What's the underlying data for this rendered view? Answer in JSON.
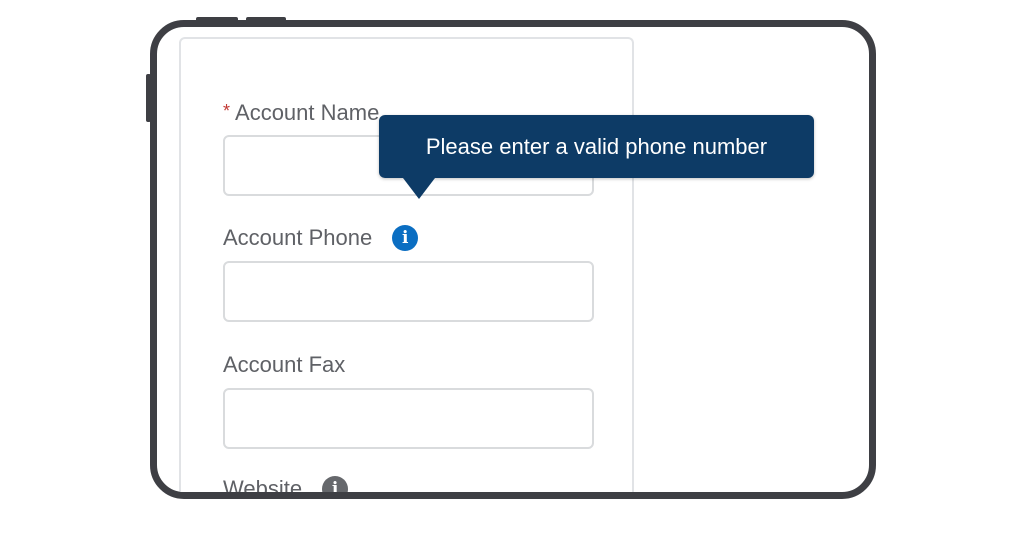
{
  "form": {
    "account_name": {
      "required_marker": "*",
      "label": "Account Name",
      "value": ""
    },
    "account_phone": {
      "label": "Account Phone",
      "info_icon": "info-icon",
      "value": ""
    },
    "account_fax": {
      "label": "Account Fax",
      "value": ""
    },
    "website": {
      "label": "Website",
      "info_icon": "info-icon"
    }
  },
  "tooltip": {
    "text": "Please enter a valid phone number"
  },
  "colors": {
    "tooltip_bg": "#0d3b66",
    "info_icon_active": "#0b6ec2",
    "info_icon_inactive": "#66686c",
    "required_marker": "#c23934",
    "device_frame": "#3e3f44"
  }
}
